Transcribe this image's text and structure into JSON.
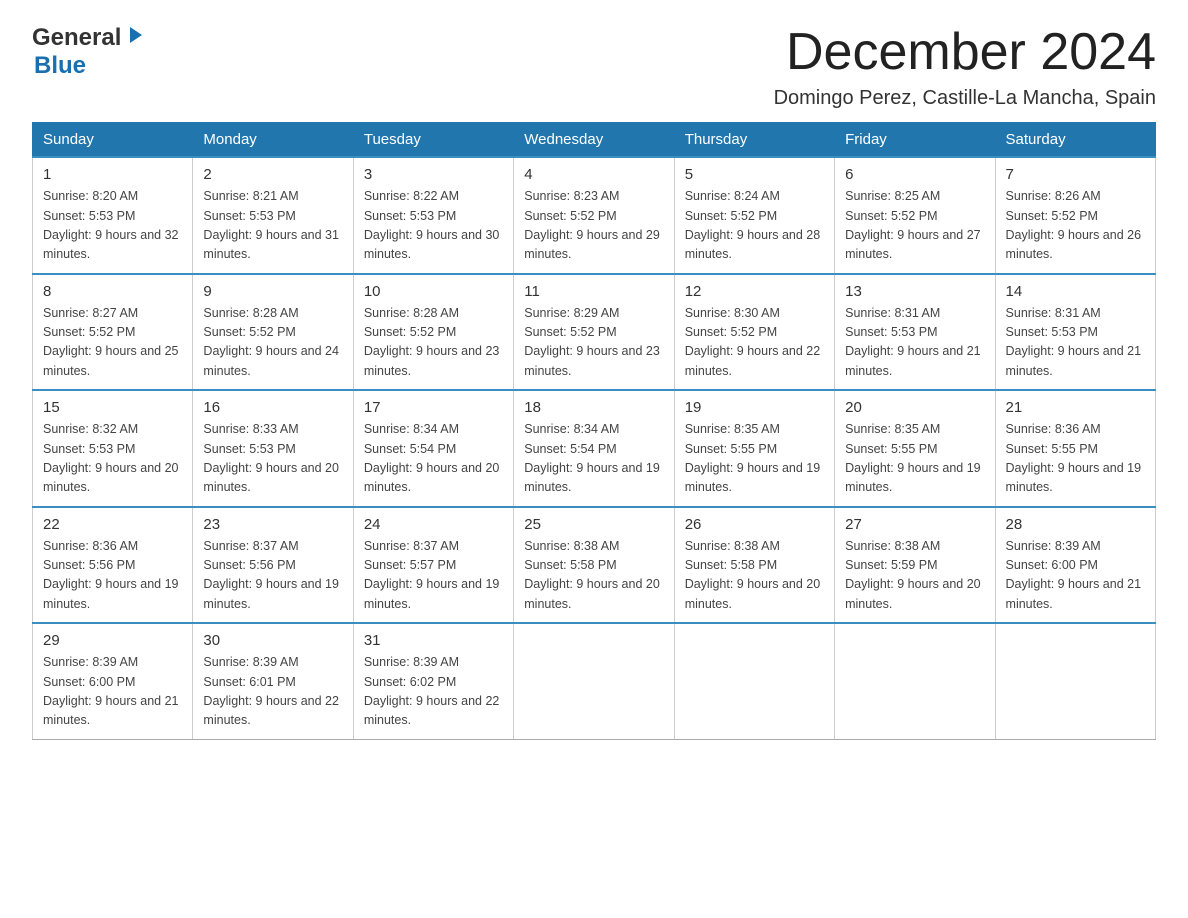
{
  "header": {
    "logo_general": "General",
    "logo_blue": "Blue",
    "month_title": "December 2024",
    "location": "Domingo Perez, Castille-La Mancha, Spain"
  },
  "days_of_week": [
    "Sunday",
    "Monday",
    "Tuesday",
    "Wednesday",
    "Thursday",
    "Friday",
    "Saturday"
  ],
  "weeks": [
    [
      {
        "day": "1",
        "sunrise": "Sunrise: 8:20 AM",
        "sunset": "Sunset: 5:53 PM",
        "daylight": "Daylight: 9 hours and 32 minutes."
      },
      {
        "day": "2",
        "sunrise": "Sunrise: 8:21 AM",
        "sunset": "Sunset: 5:53 PM",
        "daylight": "Daylight: 9 hours and 31 minutes."
      },
      {
        "day": "3",
        "sunrise": "Sunrise: 8:22 AM",
        "sunset": "Sunset: 5:53 PM",
        "daylight": "Daylight: 9 hours and 30 minutes."
      },
      {
        "day": "4",
        "sunrise": "Sunrise: 8:23 AM",
        "sunset": "Sunset: 5:52 PM",
        "daylight": "Daylight: 9 hours and 29 minutes."
      },
      {
        "day": "5",
        "sunrise": "Sunrise: 8:24 AM",
        "sunset": "Sunset: 5:52 PM",
        "daylight": "Daylight: 9 hours and 28 minutes."
      },
      {
        "day": "6",
        "sunrise": "Sunrise: 8:25 AM",
        "sunset": "Sunset: 5:52 PM",
        "daylight": "Daylight: 9 hours and 27 minutes."
      },
      {
        "day": "7",
        "sunrise": "Sunrise: 8:26 AM",
        "sunset": "Sunset: 5:52 PM",
        "daylight": "Daylight: 9 hours and 26 minutes."
      }
    ],
    [
      {
        "day": "8",
        "sunrise": "Sunrise: 8:27 AM",
        "sunset": "Sunset: 5:52 PM",
        "daylight": "Daylight: 9 hours and 25 minutes."
      },
      {
        "day": "9",
        "sunrise": "Sunrise: 8:28 AM",
        "sunset": "Sunset: 5:52 PM",
        "daylight": "Daylight: 9 hours and 24 minutes."
      },
      {
        "day": "10",
        "sunrise": "Sunrise: 8:28 AM",
        "sunset": "Sunset: 5:52 PM",
        "daylight": "Daylight: 9 hours and 23 minutes."
      },
      {
        "day": "11",
        "sunrise": "Sunrise: 8:29 AM",
        "sunset": "Sunset: 5:52 PM",
        "daylight": "Daylight: 9 hours and 23 minutes."
      },
      {
        "day": "12",
        "sunrise": "Sunrise: 8:30 AM",
        "sunset": "Sunset: 5:52 PM",
        "daylight": "Daylight: 9 hours and 22 minutes."
      },
      {
        "day": "13",
        "sunrise": "Sunrise: 8:31 AM",
        "sunset": "Sunset: 5:53 PM",
        "daylight": "Daylight: 9 hours and 21 minutes."
      },
      {
        "day": "14",
        "sunrise": "Sunrise: 8:31 AM",
        "sunset": "Sunset: 5:53 PM",
        "daylight": "Daylight: 9 hours and 21 minutes."
      }
    ],
    [
      {
        "day": "15",
        "sunrise": "Sunrise: 8:32 AM",
        "sunset": "Sunset: 5:53 PM",
        "daylight": "Daylight: 9 hours and 20 minutes."
      },
      {
        "day": "16",
        "sunrise": "Sunrise: 8:33 AM",
        "sunset": "Sunset: 5:53 PM",
        "daylight": "Daylight: 9 hours and 20 minutes."
      },
      {
        "day": "17",
        "sunrise": "Sunrise: 8:34 AM",
        "sunset": "Sunset: 5:54 PM",
        "daylight": "Daylight: 9 hours and 20 minutes."
      },
      {
        "day": "18",
        "sunrise": "Sunrise: 8:34 AM",
        "sunset": "Sunset: 5:54 PM",
        "daylight": "Daylight: 9 hours and 19 minutes."
      },
      {
        "day": "19",
        "sunrise": "Sunrise: 8:35 AM",
        "sunset": "Sunset: 5:55 PM",
        "daylight": "Daylight: 9 hours and 19 minutes."
      },
      {
        "day": "20",
        "sunrise": "Sunrise: 8:35 AM",
        "sunset": "Sunset: 5:55 PM",
        "daylight": "Daylight: 9 hours and 19 minutes."
      },
      {
        "day": "21",
        "sunrise": "Sunrise: 8:36 AM",
        "sunset": "Sunset: 5:55 PM",
        "daylight": "Daylight: 9 hours and 19 minutes."
      }
    ],
    [
      {
        "day": "22",
        "sunrise": "Sunrise: 8:36 AM",
        "sunset": "Sunset: 5:56 PM",
        "daylight": "Daylight: 9 hours and 19 minutes."
      },
      {
        "day": "23",
        "sunrise": "Sunrise: 8:37 AM",
        "sunset": "Sunset: 5:56 PM",
        "daylight": "Daylight: 9 hours and 19 minutes."
      },
      {
        "day": "24",
        "sunrise": "Sunrise: 8:37 AM",
        "sunset": "Sunset: 5:57 PM",
        "daylight": "Daylight: 9 hours and 19 minutes."
      },
      {
        "day": "25",
        "sunrise": "Sunrise: 8:38 AM",
        "sunset": "Sunset: 5:58 PM",
        "daylight": "Daylight: 9 hours and 20 minutes."
      },
      {
        "day": "26",
        "sunrise": "Sunrise: 8:38 AM",
        "sunset": "Sunset: 5:58 PM",
        "daylight": "Daylight: 9 hours and 20 minutes."
      },
      {
        "day": "27",
        "sunrise": "Sunrise: 8:38 AM",
        "sunset": "Sunset: 5:59 PM",
        "daylight": "Daylight: 9 hours and 20 minutes."
      },
      {
        "day": "28",
        "sunrise": "Sunrise: 8:39 AM",
        "sunset": "Sunset: 6:00 PM",
        "daylight": "Daylight: 9 hours and 21 minutes."
      }
    ],
    [
      {
        "day": "29",
        "sunrise": "Sunrise: 8:39 AM",
        "sunset": "Sunset: 6:00 PM",
        "daylight": "Daylight: 9 hours and 21 minutes."
      },
      {
        "day": "30",
        "sunrise": "Sunrise: 8:39 AM",
        "sunset": "Sunset: 6:01 PM",
        "daylight": "Daylight: 9 hours and 22 minutes."
      },
      {
        "day": "31",
        "sunrise": "Sunrise: 8:39 AM",
        "sunset": "Sunset: 6:02 PM",
        "daylight": "Daylight: 9 hours and 22 minutes."
      },
      null,
      null,
      null,
      null
    ]
  ]
}
